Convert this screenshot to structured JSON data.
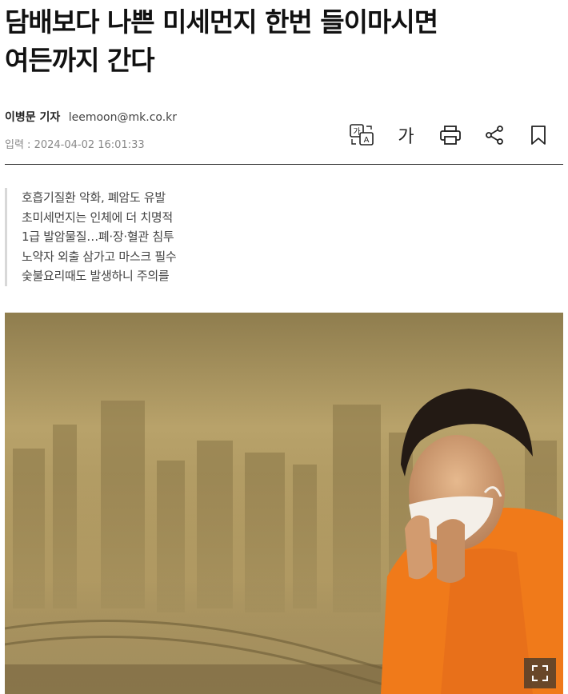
{
  "article": {
    "headline_line1": "담배보다 나쁜 미세먼지 한번 들이마시면",
    "headline_line2": "여든까지 간다",
    "reporter": "이병문 기자",
    "email": "leemoon@mk.co.kr",
    "date_label": "입력 :",
    "date": "2024-04-02 16:01:33"
  },
  "toolbar": {
    "font_size_label": "가"
  },
  "summary": [
    "호흡기질환 악화, 폐암도 유발",
    "초미세먼지는 인체에 더 치명적",
    "1급 발암물질…폐·장·혈관 침투",
    "노약자 외출 삼가고 마스크 필수",
    "숯불요리때도 발생하니 주의를"
  ],
  "icons": {
    "translate": "translate-icon",
    "print": "print-icon",
    "share": "share-icon",
    "bookmark": "bookmark-icon",
    "expand": "expand-icon"
  },
  "colors": {
    "rule": "#222222",
    "summary_border": "#d8d8d8",
    "photo_haze": "#b39c62",
    "shirt": "#f07a1a"
  }
}
